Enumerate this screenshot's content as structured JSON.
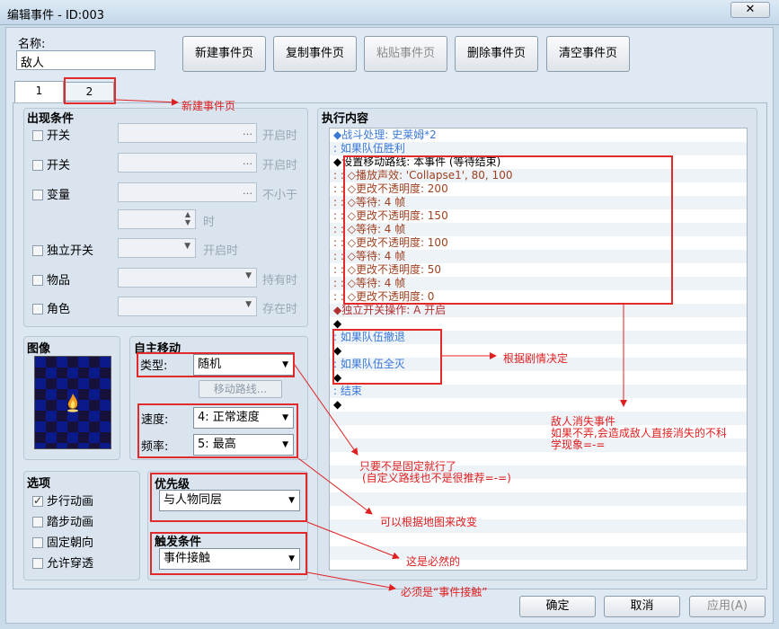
{
  "window": {
    "title": "编辑事件 - ID:003",
    "close": "✕"
  },
  "name": {
    "label": "名称:",
    "value": "敌人"
  },
  "toolbar": [
    "新建事件页",
    "复制事件页",
    "粘贴事件页",
    "删除事件页",
    "清空事件页"
  ],
  "tabs": [
    "1",
    "2"
  ],
  "conditions": {
    "title": "出现条件",
    "switch1": "开关",
    "switch1_suffix": "开启时",
    "switch2": "开关",
    "switch2_suffix": "开启时",
    "variable": "变量",
    "variable_suffix": "不小于",
    "time_suffix": "时",
    "selfswitch": "独立开关",
    "selfswitch_suffix": "开启时",
    "item": "物品",
    "item_suffix": "持有时",
    "actor": "角色",
    "actor_suffix": "存在时"
  },
  "image": {
    "title": "图像"
  },
  "autonomous": {
    "title": "自主移动",
    "type_label": "类型:",
    "type_value": "随机",
    "route_button": "移动路线...",
    "speed_label": "速度:",
    "speed_value": "4: 正常速度",
    "freq_label": "频率:",
    "freq_value": "5: 最高"
  },
  "options": {
    "title": "选项",
    "walk": "步行动画",
    "step": "踏步动画",
    "fixed": "固定朝向",
    "through": "允许穿透"
  },
  "priority": {
    "title": "优先级",
    "value": "与人物同层"
  },
  "trigger": {
    "title": "触发条件",
    "value": "事件接触"
  },
  "contents": {
    "title": "执行内容",
    "lines": [
      "◆战斗处理: 史莱姆*2",
      ": 如果队伍胜利",
      "  ◆设置移动路线: 本事件 (等待结束)",
      "  :              : ◇播放声效: 'Collapse1', 80, 100",
      "  :              : ◇更改不透明度: 200",
      "  :              : ◇等待: 4 帧",
      "  :              : ◇更改不透明度: 150",
      "  :              : ◇等待: 4 帧",
      "  :              : ◇更改不透明度: 100",
      "  :              : ◇等待: 4 帧",
      "  :              : ◇更改不透明度: 50",
      "  :              : ◇等待: 4 帧",
      "  :              : ◇更改不透明度: 0",
      "  ◆独立开关操作: A 开启",
      "  ◆",
      ": 如果队伍撤退",
      "  ◆",
      ": 如果队伍全灭",
      "  ◆",
      ": 结束",
      "◆"
    ]
  },
  "footer": {
    "ok": "确定",
    "cancel": "取消",
    "apply": "应用(A)"
  },
  "annotations": {
    "new_page": "新建事件页",
    "by_story": "根据剧情决定",
    "vanish1": "敌人消失事件",
    "vanish2": "如果不弄,会造成敌人直接消失的不科",
    "vanish3": "学现象=-=",
    "notfixed1": "只要不是固定就行了",
    "notfixed2": "(自定义路线也不是很推荐=-=)",
    "bymap": "可以根据地图来改变",
    "must": "这是必然的",
    "mustbe": "必须是“事件接触”"
  },
  "colors": {
    "annotation": "#e02020",
    "link": "#3a78d8"
  }
}
